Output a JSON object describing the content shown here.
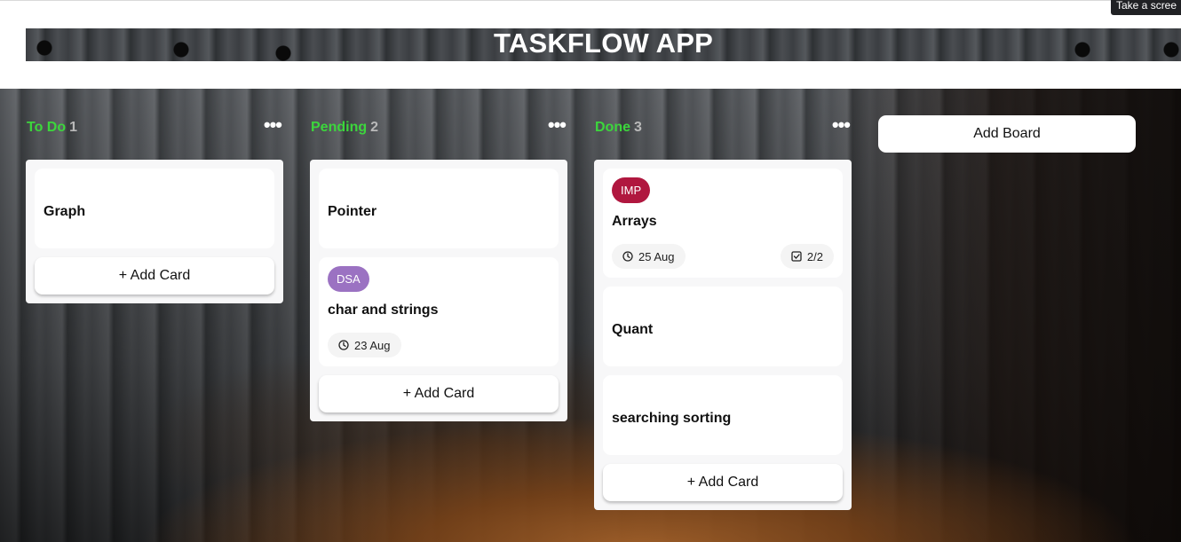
{
  "app": {
    "title": "TASKFLOW APP"
  },
  "tooltip": {
    "text": "Take a scree"
  },
  "add_board_label": "Add Board",
  "columns": [
    {
      "title": "To Do",
      "count": "1",
      "add_card_label": "+ Add Card",
      "cards": [
        {
          "title": "Graph"
        }
      ]
    },
    {
      "title": "Pending",
      "count": "2",
      "add_card_label": "+ Add Card",
      "cards": [
        {
          "title": "Pointer"
        },
        {
          "title": "char and strings",
          "tag": "DSA",
          "tag_color": "#9b72c2",
          "date": "23 Aug"
        }
      ]
    },
    {
      "title": "Done",
      "count": "3",
      "add_card_label": "+ Add Card",
      "cards": [
        {
          "title": "Arrays",
          "tag": "IMP",
          "tag_color": "#b0173f",
          "date": "25 Aug",
          "tasks": "2/2"
        },
        {
          "title": "Quant"
        },
        {
          "title": "searching sorting"
        }
      ]
    }
  ],
  "colors": {
    "column_title": "#3cd63c",
    "count": "#b9b9b9",
    "column_bg": "#f7f7f8"
  },
  "icons": {
    "menu": "more-horizontal-icon",
    "date": "clock-icon",
    "tasks": "checkbox-icon"
  }
}
